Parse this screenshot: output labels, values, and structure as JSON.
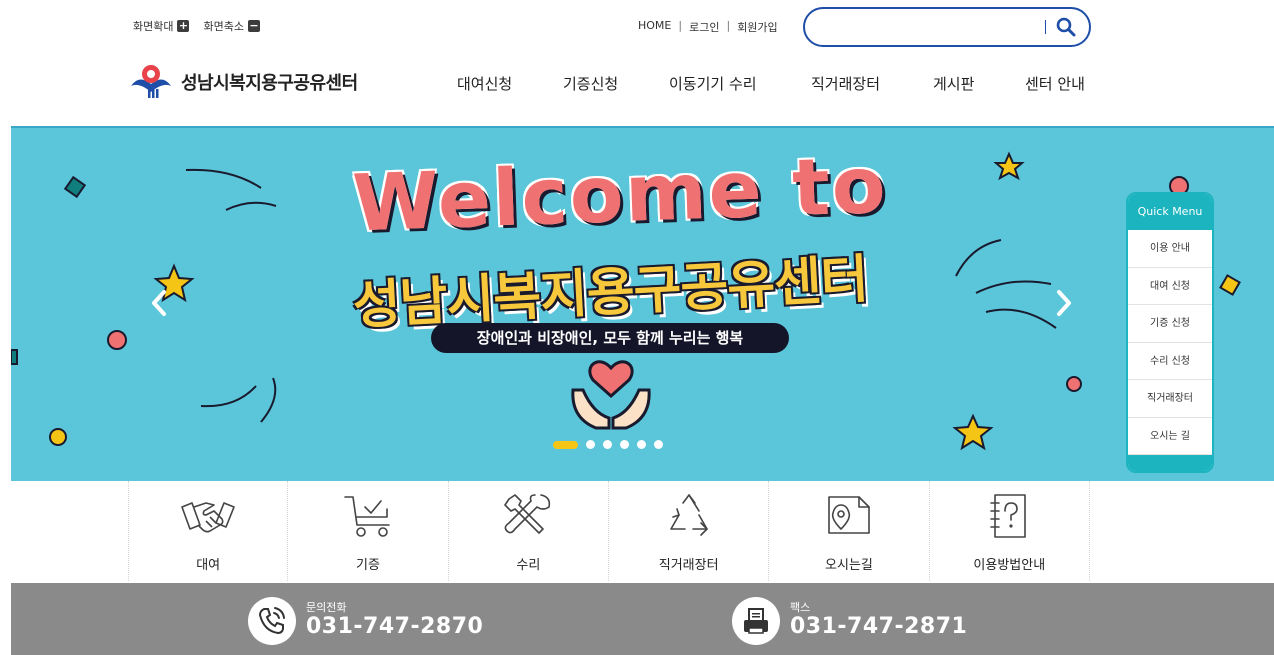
{
  "zoom": {
    "zoom_in_label": "화면확대",
    "zoom_out_label": "화면축소"
  },
  "util": {
    "home": "HOME",
    "login": "로그인",
    "join": "회원가입",
    "sep": "|"
  },
  "search": {
    "placeholder": "",
    "value": "",
    "icon": "search-icon"
  },
  "logo": {
    "text": "성남시복지용구공유센터"
  },
  "nav": {
    "items": [
      "대여신청",
      "기증신청",
      "이동기기 수리",
      "직거래장터",
      "게시판",
      "센터 안내"
    ]
  },
  "banner": {
    "headline": "Welcome to",
    "name": "성남시복지용구공유센터",
    "slogan": "장애인과 비장애인, 모두 함께 누리는 행복",
    "slide_count": 6,
    "active_slide": 1,
    "colors": {
      "background": "#5bc6d9",
      "headline": "#f07171",
      "name": "#f7c83c",
      "slogan_bg": "#15152a"
    }
  },
  "quick_menu": {
    "title": "Quick Menu",
    "items": [
      "이용 안내",
      "대여 신청",
      "기증 신청",
      "수리 신청",
      "직거래장터",
      "오시는 길"
    ],
    "color": "#1cb4bf"
  },
  "services": [
    {
      "label": "대여",
      "icon": "handshake-icon"
    },
    {
      "label": "기증",
      "icon": "cart-icon"
    },
    {
      "label": "수리",
      "icon": "tools-icon"
    },
    {
      "label": "직거래장터",
      "icon": "recycle-icon"
    },
    {
      "label": "오시는길",
      "icon": "map-pin-icon"
    },
    {
      "label": "이용방법안내",
      "icon": "help-book-icon"
    }
  ],
  "contact": {
    "phone_label": "문의전화",
    "phone": "031-747-2870",
    "fax_label": "팩스",
    "fax": "031-747-2871"
  }
}
